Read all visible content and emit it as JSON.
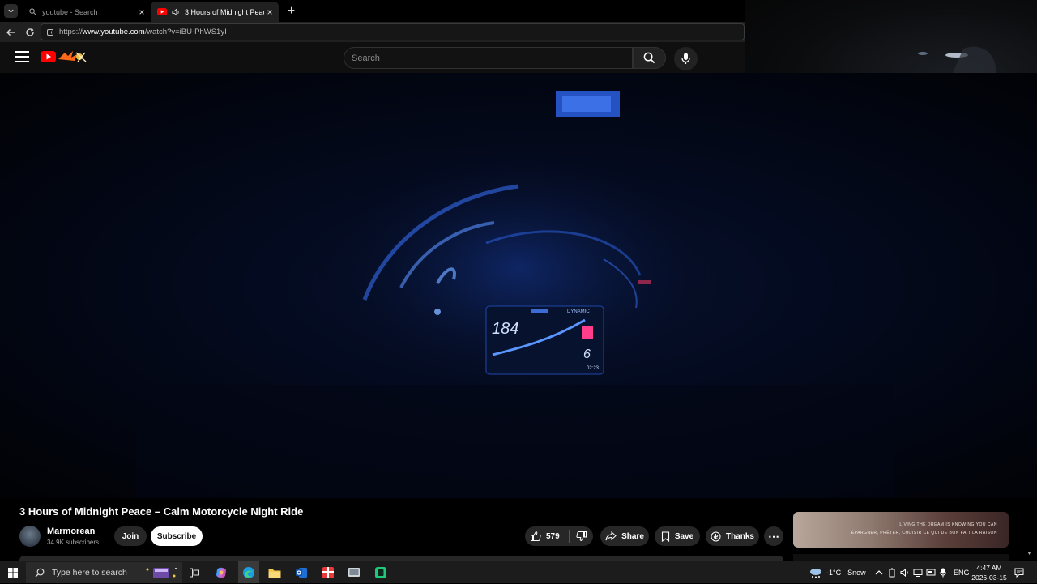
{
  "browser": {
    "tabs": [
      {
        "title": "youtube - Search",
        "active": false
      },
      {
        "title": "3 Hours of Midnight Peace – Calm Motorcycle Night Ride",
        "active": true
      }
    ],
    "url_scheme": "https://",
    "url_host": "www.youtube.com",
    "url_path": "/watch?v=iBU-PhWS1yI",
    "new_tab_label": "+"
  },
  "masthead": {
    "search_placeholder": "Search"
  },
  "video": {
    "title": "3 Hours of Midnight Peace – Calm Motorcycle Night Ride",
    "dash_speed": "184",
    "dash_mode": "DYNAMIC",
    "dash_gear": "6",
    "dash_time": "02:23"
  },
  "channel": {
    "name": "Marmorean",
    "subscribers": "34.9K subscribers"
  },
  "actions": {
    "join": "Join",
    "subscribe": "Subscribe",
    "likes": "579",
    "share": "Share",
    "save": "Save",
    "thanks": "Thanks"
  },
  "ad": {
    "line1": "LIVING THE DREAM IS KNOWING YOU CAN",
    "line2": "ÉPARGNER, PRÊTER, CHOISIR CE QUI DE BON FAIT LA RAISON"
  },
  "taskbar": {
    "search_placeholder": "Type here to search",
    "weather_temp": "-1°C",
    "weather_text": "Snow",
    "language": "ENG",
    "time": "4:47 AM",
    "date": "2026-03-15"
  },
  "colors": {
    "youtube_red": "#ff0000",
    "dash_blue": "#3a7bff",
    "page_bg": "#0f0f0f",
    "taskbar_bg": "#1c1c1c"
  }
}
